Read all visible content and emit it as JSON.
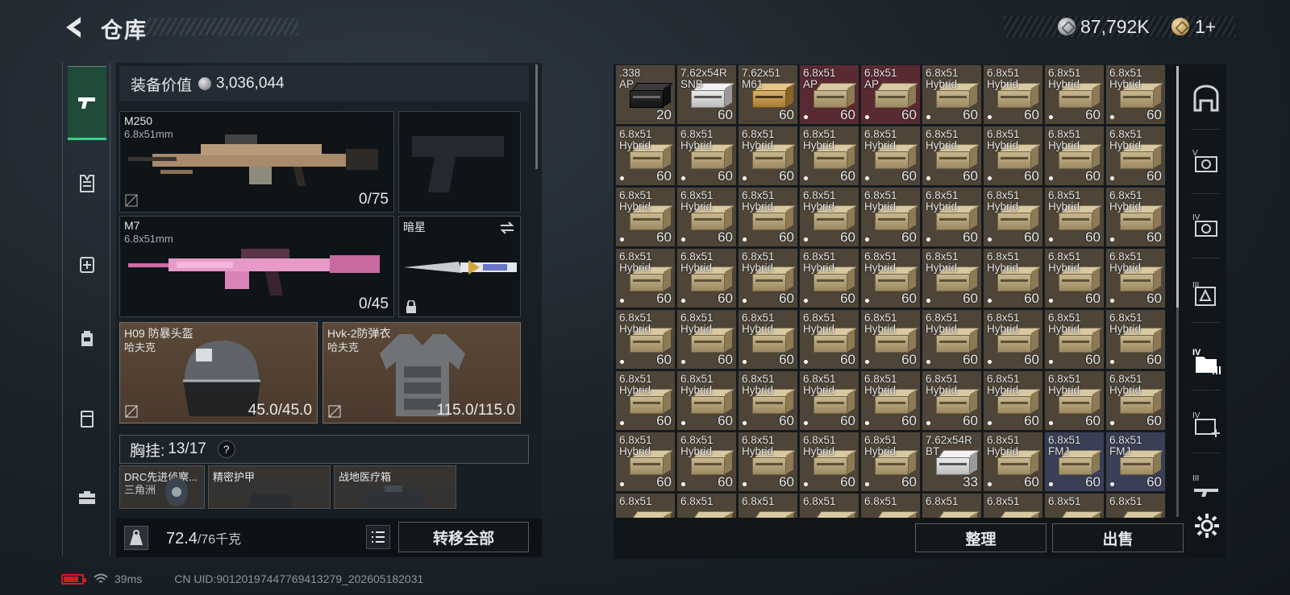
{
  "header": {
    "title": "仓库",
    "money": "87,792K",
    "gold": "1+"
  },
  "equipment": {
    "value_label": "装备价值",
    "value": "3,036,044",
    "primary": {
      "name": "M250",
      "caliber": "6.8x51mm",
      "ammo": "0/75"
    },
    "secondary": {
      "name": "M7",
      "caliber": "6.8x51mm",
      "ammo": "0/45"
    },
    "melee": {
      "name": "暗星"
    },
    "helmet": {
      "name": "H09 防暴头盔",
      "maker": "哈夫克",
      "durability": "45.0/45.0"
    },
    "armor": {
      "name": "Hvk-2防弹衣",
      "maker": "哈夫克",
      "durability": "115.0/115.0"
    }
  },
  "vest": {
    "label": "胸挂:",
    "count": "13/17",
    "help": "?",
    "items": [
      {
        "name": "DRC先进侦察...",
        "sub": "三角洲"
      },
      {
        "name": "精密护甲",
        "sub": ""
      },
      {
        "name": "战地医疗箱",
        "sub": ""
      }
    ]
  },
  "weight": {
    "current": "72.4",
    "max": "/76千克"
  },
  "buttons": {
    "transfer_all": "转移全部",
    "sort": "整理",
    "sell": "出售"
  },
  "status": {
    "ping": "39ms",
    "uid": "CN UID:9012019744776941327​9_202605182031"
  },
  "colors": {
    "accent_green": "#37d38a",
    "cell_brown": "#4e4538",
    "cell_red": "#5a2a32",
    "cell_blue": "#3a3f55"
  },
  "grid": {
    "rows": [
      [
        {
          "t1": ".338",
          "t2": "AP",
          "q": "20",
          "c": "brown",
          "k": "can",
          "dot": false
        },
        {
          "t1": "7.62x54R",
          "t2": "SNB",
          "q": "60",
          "c": "brown",
          "k": "white",
          "dot": false
        },
        {
          "t1": "7.62x51",
          "t2": "M61",
          "q": "60",
          "c": "brown",
          "k": "gold",
          "dot": false
        },
        {
          "t1": "6.8x51",
          "t2": "AP",
          "q": "60",
          "c": "red",
          "k": "box",
          "dot": true
        },
        {
          "t1": "6.8x51",
          "t2": "AP",
          "q": "60",
          "c": "red",
          "k": "box",
          "dot": true
        },
        {
          "t1": "6.8x51",
          "t2": "Hybrid",
          "q": "60",
          "c": "brown",
          "k": "box",
          "dot": true
        },
        {
          "t1": "6.8x51",
          "t2": "Hybrid",
          "q": "60",
          "c": "brown",
          "k": "box",
          "dot": true
        },
        {
          "t1": "6.8x51",
          "t2": "Hybrid",
          "q": "60",
          "c": "brown",
          "k": "box",
          "dot": true
        },
        {
          "t1": "6.8x51",
          "t2": "Hybrid",
          "q": "60",
          "c": "brown",
          "k": "box",
          "dot": true
        }
      ],
      [
        {
          "t1": "6.8x51",
          "t2": "Hybrid",
          "q": "60",
          "c": "brown",
          "k": "box",
          "dot": true
        },
        {
          "t1": "6.8x51",
          "t2": "Hybrid",
          "q": "60",
          "c": "brown",
          "k": "box",
          "dot": true
        },
        {
          "t1": "6.8x51",
          "t2": "Hybrid",
          "q": "60",
          "c": "brown",
          "k": "box",
          "dot": true
        },
        {
          "t1": "6.8x51",
          "t2": "Hybrid",
          "q": "60",
          "c": "brown",
          "k": "box",
          "dot": true
        },
        {
          "t1": "6.8x51",
          "t2": "Hybrid",
          "q": "60",
          "c": "brown",
          "k": "box",
          "dot": true
        },
        {
          "t1": "6.8x51",
          "t2": "Hybrid",
          "q": "60",
          "c": "brown",
          "k": "box",
          "dot": true
        },
        {
          "t1": "6.8x51",
          "t2": "Hybrid",
          "q": "60",
          "c": "brown",
          "k": "box",
          "dot": true
        },
        {
          "t1": "6.8x51",
          "t2": "Hybrid",
          "q": "60",
          "c": "brown",
          "k": "box",
          "dot": true
        },
        {
          "t1": "6.8x51",
          "t2": "Hybrid",
          "q": "60",
          "c": "brown",
          "k": "box",
          "dot": true
        }
      ],
      [
        {
          "t1": "6.8x51",
          "t2": "Hybrid",
          "q": "60",
          "c": "brown",
          "k": "box",
          "dot": true
        },
        {
          "t1": "6.8x51",
          "t2": "Hybrid",
          "q": "60",
          "c": "brown",
          "k": "box",
          "dot": true
        },
        {
          "t1": "6.8x51",
          "t2": "Hybrid",
          "q": "60",
          "c": "brown",
          "k": "box",
          "dot": true
        },
        {
          "t1": "6.8x51",
          "t2": "Hybrid",
          "q": "60",
          "c": "brown",
          "k": "box",
          "dot": true
        },
        {
          "t1": "6.8x51",
          "t2": "Hybrid",
          "q": "60",
          "c": "brown",
          "k": "box",
          "dot": true
        },
        {
          "t1": "6.8x51",
          "t2": "Hybrid",
          "q": "60",
          "c": "brown",
          "k": "box",
          "dot": true
        },
        {
          "t1": "6.8x51",
          "t2": "Hybrid",
          "q": "60",
          "c": "brown",
          "k": "box",
          "dot": true
        },
        {
          "t1": "6.8x51",
          "t2": "Hybrid",
          "q": "60",
          "c": "brown",
          "k": "box",
          "dot": true
        },
        {
          "t1": "6.8x51",
          "t2": "Hybrid",
          "q": "60",
          "c": "brown",
          "k": "box",
          "dot": true
        }
      ],
      [
        {
          "t1": "6.8x51",
          "t2": "Hybrid",
          "q": "60",
          "c": "brown",
          "k": "box",
          "dot": true
        },
        {
          "t1": "6.8x51",
          "t2": "Hybrid",
          "q": "60",
          "c": "brown",
          "k": "box",
          "dot": true
        },
        {
          "t1": "6.8x51",
          "t2": "Hybrid",
          "q": "60",
          "c": "brown",
          "k": "box",
          "dot": true
        },
        {
          "t1": "6.8x51",
          "t2": "Hybrid",
          "q": "60",
          "c": "brown",
          "k": "box",
          "dot": true
        },
        {
          "t1": "6.8x51",
          "t2": "Hybrid",
          "q": "60",
          "c": "brown",
          "k": "box",
          "dot": true
        },
        {
          "t1": "6.8x51",
          "t2": "Hybrid",
          "q": "60",
          "c": "brown",
          "k": "box",
          "dot": true
        },
        {
          "t1": "6.8x51",
          "t2": "Hybrid",
          "q": "60",
          "c": "brown",
          "k": "box",
          "dot": true
        },
        {
          "t1": "6.8x51",
          "t2": "Hybrid",
          "q": "60",
          "c": "brown",
          "k": "box",
          "dot": true
        },
        {
          "t1": "6.8x51",
          "t2": "Hybrid",
          "q": "60",
          "c": "brown",
          "k": "box",
          "dot": true
        }
      ],
      [
        {
          "t1": "6.8x51",
          "t2": "Hybrid",
          "q": "60",
          "c": "brown",
          "k": "box",
          "dot": true
        },
        {
          "t1": "6.8x51",
          "t2": "Hybrid",
          "q": "60",
          "c": "brown",
          "k": "box",
          "dot": true
        },
        {
          "t1": "6.8x51",
          "t2": "Hybrid",
          "q": "60",
          "c": "brown",
          "k": "box",
          "dot": true
        },
        {
          "t1": "6.8x51",
          "t2": "Hybrid",
          "q": "60",
          "c": "brown",
          "k": "box",
          "dot": true
        },
        {
          "t1": "6.8x51",
          "t2": "Hybrid",
          "q": "60",
          "c": "brown",
          "k": "box",
          "dot": true
        },
        {
          "t1": "6.8x51",
          "t2": "Hybrid",
          "q": "60",
          "c": "brown",
          "k": "box",
          "dot": true
        },
        {
          "t1": "6.8x51",
          "t2": "Hybrid",
          "q": "60",
          "c": "brown",
          "k": "box",
          "dot": true
        },
        {
          "t1": "6.8x51",
          "t2": "Hybrid",
          "q": "60",
          "c": "brown",
          "k": "box",
          "dot": true
        },
        {
          "t1": "6.8x51",
          "t2": "Hybrid",
          "q": "60",
          "c": "brown",
          "k": "box",
          "dot": true
        }
      ],
      [
        {
          "t1": "6.8x51",
          "t2": "Hybrid",
          "q": "60",
          "c": "brown",
          "k": "box",
          "dot": true
        },
        {
          "t1": "6.8x51",
          "t2": "Hybrid",
          "q": "60",
          "c": "brown",
          "k": "box",
          "dot": true
        },
        {
          "t1": "6.8x51",
          "t2": "Hybrid",
          "q": "60",
          "c": "brown",
          "k": "box",
          "dot": true
        },
        {
          "t1": "6.8x51",
          "t2": "Hybrid",
          "q": "60",
          "c": "brown",
          "k": "box",
          "dot": true
        },
        {
          "t1": "6.8x51",
          "t2": "Hybrid",
          "q": "60",
          "c": "brown",
          "k": "box",
          "dot": true
        },
        {
          "t1": "6.8x51",
          "t2": "Hybrid",
          "q": "60",
          "c": "brown",
          "k": "box",
          "dot": true
        },
        {
          "t1": "6.8x51",
          "t2": "Hybrid",
          "q": "60",
          "c": "brown",
          "k": "box",
          "dot": true
        },
        {
          "t1": "6.8x51",
          "t2": "Hybrid",
          "q": "60",
          "c": "brown",
          "k": "box",
          "dot": true
        },
        {
          "t1": "6.8x51",
          "t2": "Hybrid",
          "q": "60",
          "c": "brown",
          "k": "box",
          "dot": true
        }
      ],
      [
        {
          "t1": "6.8x51",
          "t2": "Hybrid",
          "q": "60",
          "c": "brown",
          "k": "box",
          "dot": true
        },
        {
          "t1": "6.8x51",
          "t2": "Hybrid",
          "q": "60",
          "c": "brown",
          "k": "box",
          "dot": true
        },
        {
          "t1": "6.8x51",
          "t2": "Hybrid",
          "q": "60",
          "c": "brown",
          "k": "box",
          "dot": true
        },
        {
          "t1": "6.8x51",
          "t2": "Hybrid",
          "q": "60",
          "c": "brown",
          "k": "box",
          "dot": true
        },
        {
          "t1": "6.8x51",
          "t2": "Hybrid",
          "q": "60",
          "c": "brown",
          "k": "box",
          "dot": true
        },
        {
          "t1": "7.62x54R",
          "t2": "BT",
          "q": "33",
          "c": "brown",
          "k": "white",
          "dot": false
        },
        {
          "t1": "6.8x51",
          "t2": "Hybrid",
          "q": "60",
          "c": "brown",
          "k": "box",
          "dot": true
        },
        {
          "t1": "6.8x51",
          "t2": "FMJ",
          "q": "60",
          "c": "blue",
          "k": "box",
          "dot": true
        },
        {
          "t1": "6.8x51",
          "t2": "FMJ",
          "q": "60",
          "c": "blue",
          "k": "box",
          "dot": true
        }
      ],
      [
        {
          "t1": "6.8x51",
          "t2": "",
          "q": "",
          "c": "brown",
          "k": "box",
          "dot": false
        },
        {
          "t1": "6.8x51",
          "t2": "",
          "q": "",
          "c": "brown",
          "k": "box",
          "dot": false
        },
        {
          "t1": "6.8x51",
          "t2": "",
          "q": "",
          "c": "brown",
          "k": "box",
          "dot": false
        },
        {
          "t1": "6.8x51",
          "t2": "",
          "q": "",
          "c": "brown",
          "k": "box",
          "dot": false
        },
        {
          "t1": "6.8x51",
          "t2": "",
          "q": "",
          "c": "brown",
          "k": "box",
          "dot": false
        },
        {
          "t1": "6.8x51",
          "t2": "",
          "q": "",
          "c": "brown",
          "k": "box",
          "dot": false
        },
        {
          "t1": "6.8x51",
          "t2": "",
          "q": "",
          "c": "brown",
          "k": "box",
          "dot": false
        },
        {
          "t1": "6.8x51",
          "t2": "",
          "q": "",
          "c": "brown",
          "k": "box",
          "dot": false
        },
        {
          "t1": "6.8x51",
          "t2": "",
          "q": "",
          "c": "brown",
          "k": "box",
          "dot": false
        }
      ]
    ]
  },
  "right_nav": [
    "home-icon",
    "tier-v-icon",
    "tier-iv-icon",
    "tier-iii-icon",
    "tier-iv-folder-icon",
    "tier-iv-medkit-icon",
    "tier-iii-rifle-icon"
  ],
  "left_nav": [
    "pistol-icon",
    "vest-icon",
    "backpack-medical-icon",
    "backpack-icon",
    "pouch-icon",
    "briefcase-icon"
  ]
}
